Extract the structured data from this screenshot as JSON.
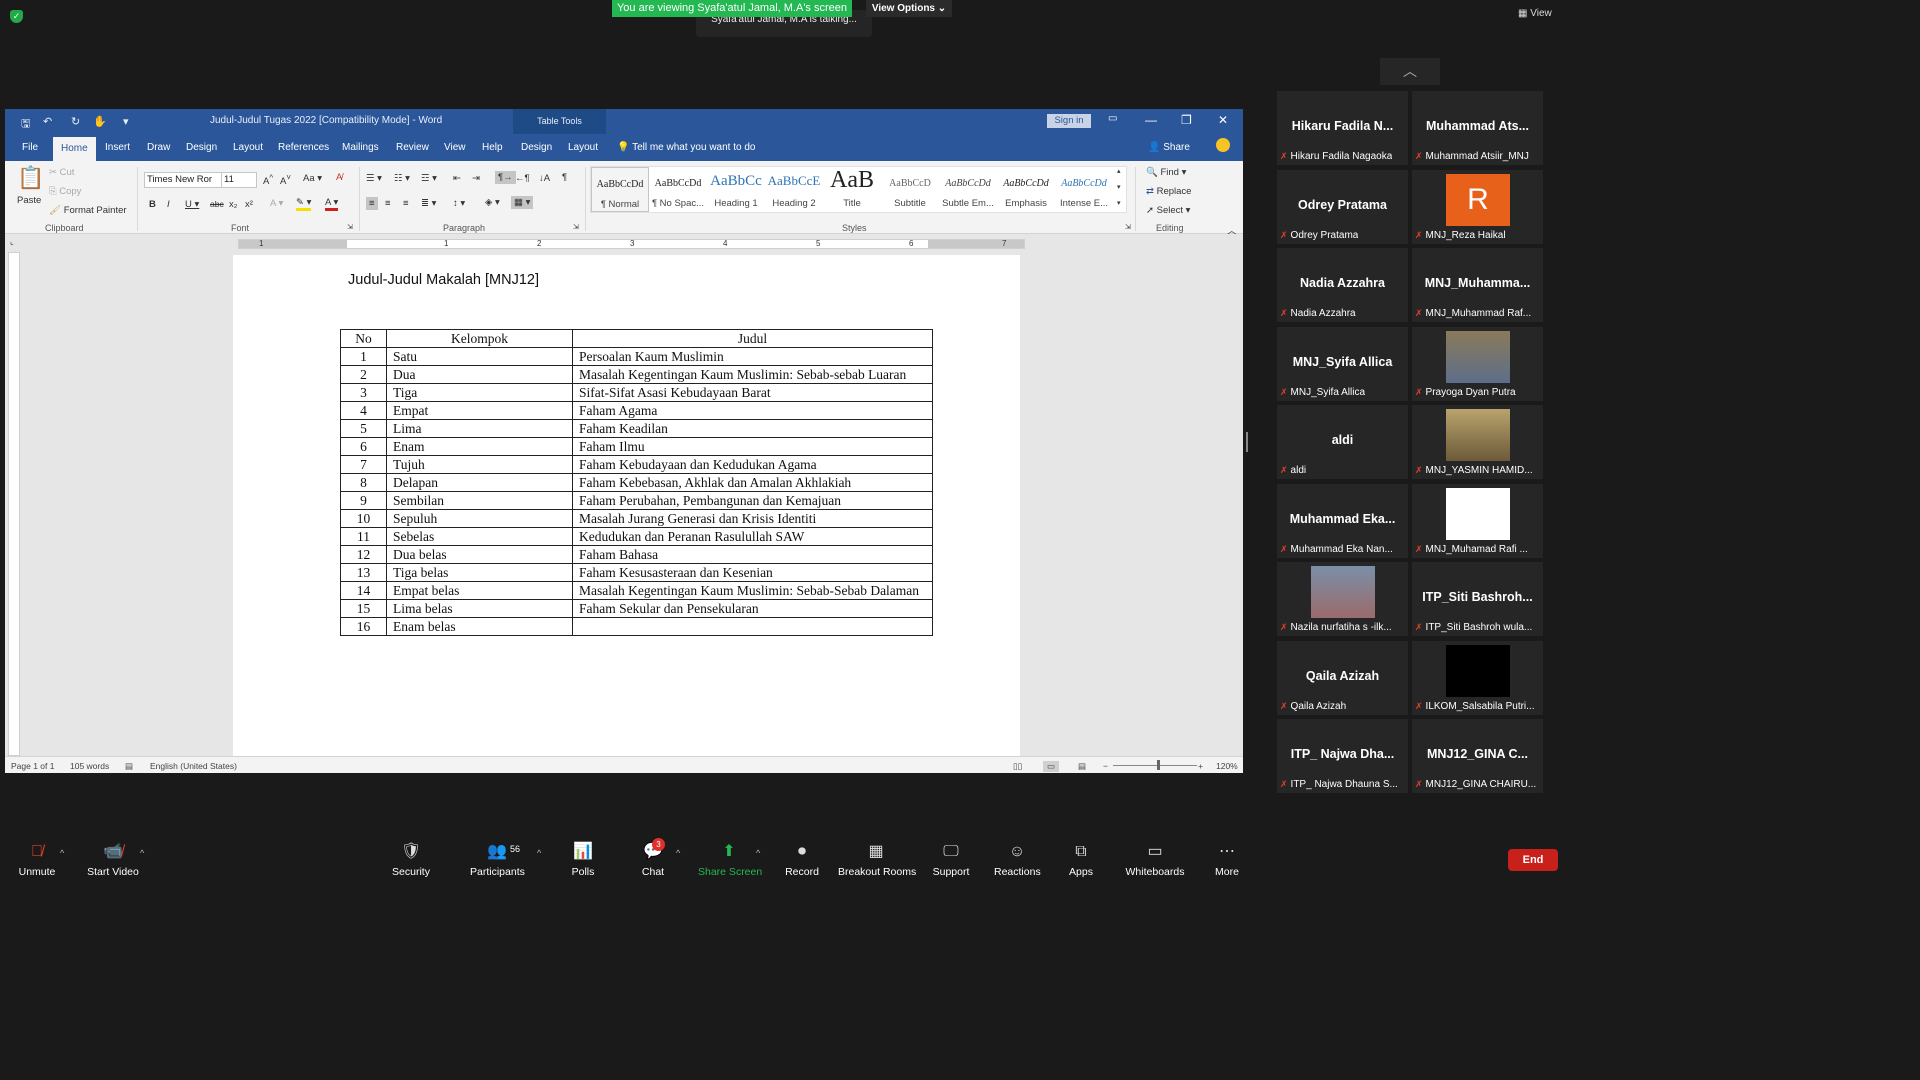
{
  "zoom": {
    "banner": "You are viewing Syafa'atul Jamal, M.A's screen",
    "view_options": "View Options",
    "talking": "Syafa'atul Jamal, M.A is talking...",
    "view_label": "View",
    "participants": [
      {
        "name": "Hikaru Fadila N...",
        "label": "Hikaru Fadila Nagaoka"
      },
      {
        "name": "Muhammad Ats...",
        "label": "Muhammad Atsiir_MNJ"
      },
      {
        "name": "Odrey Pratama",
        "label": "Odrey Pratama"
      },
      {
        "name": "R",
        "label": "MNJ_Reza Haikal"
      },
      {
        "name": "Nadia Azzahra",
        "label": "Nadia Azzahra"
      },
      {
        "name": "MNJ_Muhamma...",
        "label": "MNJ_Muhammad Raf..."
      },
      {
        "name": "MNJ_Syifa Allica",
        "label": "MNJ_Syifa Allica"
      },
      {
        "name": "",
        "label": "Prayoga Dyan Putra"
      },
      {
        "name": "aldi",
        "label": "aldi"
      },
      {
        "name": "",
        "label": "MNJ_YASMIN HAMID..."
      },
      {
        "name": "Muhammad  Eka...",
        "label": "Muhammad Eka Nan..."
      },
      {
        "name": "",
        "label": "MNJ_Muhamad Rafi ..."
      },
      {
        "name": "",
        "label": "Nazila nurfatiha s -ilk..."
      },
      {
        "name": "ITP_Siti  Bashroh...",
        "label": "ITP_Siti Bashroh wula..."
      },
      {
        "name": "Qaila Azizah",
        "label": "Qaila Azizah"
      },
      {
        "name": "",
        "label": "ILKOM_Salsabila Putri..."
      },
      {
        "name": "ITP_ Najwa Dha...",
        "label": "ITP_ Najwa Dhauna S..."
      },
      {
        "name": "MNJ12_GINA  C...",
        "label": "MNJ12_GINA CHAIRU..."
      }
    ],
    "toolbar": {
      "unmute": "Unmute",
      "start_video": "Start Video",
      "security": "Security",
      "participants": "Participants",
      "participants_count": "56",
      "polls": "Polls",
      "chat": "Chat",
      "chat_badge": "3",
      "share_screen": "Share Screen",
      "record": "Record",
      "breakout": "Breakout Rooms",
      "support": "Support",
      "reactions": "Reactions",
      "apps": "Apps",
      "whiteboards": "Whiteboards",
      "more": "More",
      "end": "End"
    }
  },
  "word": {
    "title": "Judul-Judul Tugas 2022 [Compatibility Mode]  -  Word",
    "table_tools": "Table Tools",
    "sign_in": "Sign in",
    "tabs": [
      "File",
      "Home",
      "Insert",
      "Draw",
      "Design",
      "Layout",
      "References",
      "Mailings",
      "Review",
      "View",
      "Help",
      "Design",
      "Layout"
    ],
    "tell_me": "Tell me what you want to do",
    "share": "Share",
    "clipboard": {
      "paste": "Paste",
      "cut": "Cut",
      "copy": "Copy",
      "format_painter": "Format Painter",
      "label": "Clipboard"
    },
    "font": {
      "name": "Times New Ror",
      "size": "11",
      "label": "Font"
    },
    "paragraph_label": "Paragraph",
    "styles": [
      {
        "preview": "AaBbCcDd",
        "name": "¶ Normal"
      },
      {
        "preview": "AaBbCcDd",
        "name": "¶ No Spac..."
      },
      {
        "preview": "AaBbCc",
        "name": "Heading 1"
      },
      {
        "preview": "AaBbCcE",
        "name": "Heading 2"
      },
      {
        "preview": "AaB",
        "name": "Title"
      },
      {
        "preview": "AaBbCcD",
        "name": "Subtitle"
      },
      {
        "preview": "AaBbCcDd",
        "name": "Subtle Em..."
      },
      {
        "preview": "AaBbCcDd",
        "name": "Emphasis"
      },
      {
        "preview": "AaBbCcDd",
        "name": "Intense E..."
      }
    ],
    "styles_label": "Styles",
    "editing": {
      "find": "Find",
      "replace": "Replace",
      "select": "Select",
      "label": "Editing"
    },
    "ruler_numbers": [
      "1",
      "1",
      "2",
      "3",
      "4",
      "5",
      "6",
      "7"
    ],
    "status": {
      "page": "Page 1 of 1",
      "words": "105 words",
      "language": "English (United States)",
      "zoom": "120%"
    }
  },
  "document": {
    "title": "Judul-Judul Makalah [MNJ12]",
    "headers": [
      "No",
      "Kelompok",
      "Judul"
    ],
    "rows": [
      [
        "1",
        "Satu",
        "Persoalan Kaum Muslimin"
      ],
      [
        "2",
        "Dua",
        "Masalah Kegentingan Kaum Muslimin: Sebab-sebab Luaran"
      ],
      [
        "3",
        "Tiga",
        "Sifat-Sifat Asasi Kebudayaan Barat"
      ],
      [
        "4",
        "Empat",
        "Faham Agama"
      ],
      [
        "5",
        "Lima",
        "Faham Keadilan"
      ],
      [
        "6",
        "Enam",
        "Faham Ilmu"
      ],
      [
        "7",
        "Tujuh",
        "Faham Kebudayaan dan Kedudukan Agama"
      ],
      [
        "8",
        "Delapan",
        "Faham Kebebasan, Akhlak dan Amalan Akhlakiah"
      ],
      [
        "9",
        "Sembilan",
        "Faham Perubahan, Pembangunan dan Kemajuan"
      ],
      [
        "10",
        "Sepuluh",
        "Masalah Jurang Generasi dan Krisis Identiti"
      ],
      [
        "11",
        "Sebelas",
        "Kedudukan dan Peranan Rasulullah SAW"
      ],
      [
        "12",
        "Dua belas",
        "Faham Bahasa"
      ],
      [
        "13",
        "Tiga belas",
        "Faham Kesusasteraan dan Kesenian"
      ],
      [
        "14",
        "Empat belas",
        "Masalah Kegentingan Kaum Muslimin: Sebab-Sebab Dalaman"
      ],
      [
        "15",
        "Lima belas",
        "Faham Sekular dan Pensekularan"
      ],
      [
        "16",
        "Enam belas",
        ""
      ]
    ]
  }
}
